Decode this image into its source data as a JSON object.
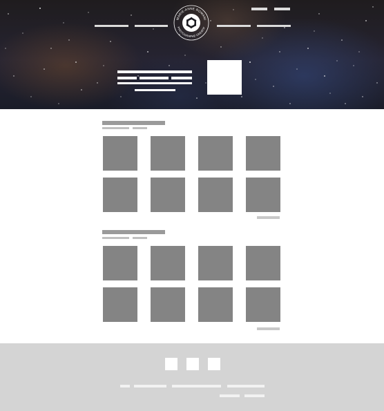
{
  "hero": {
    "logo": {
      "text_top": "MARIE-ANNE ROMANI",
      "text_bottom": "PHOTOGRAPHE CREATIF",
      "icon": "camera-aperture-icon"
    },
    "background": "night sky with stars",
    "nav_left": [
      "",
      ""
    ],
    "nav_right": [
      "",
      ""
    ],
    "top_links": [
      "",
      ""
    ]
  },
  "sections": [
    {
      "thumbnail_rows": 2,
      "thumbnail_cols": 4
    },
    {
      "thumbnail_rows": 2,
      "thumbnail_cols": 4
    }
  ],
  "footer": {
    "social_icons": [
      "social-icon-1",
      "social-icon-2",
      "social-icon-3"
    ]
  },
  "colors": {
    "placeholder_gray": "#848484",
    "footer_gray": "#d4d4d4",
    "title_gray": "#9a9a9a"
  }
}
